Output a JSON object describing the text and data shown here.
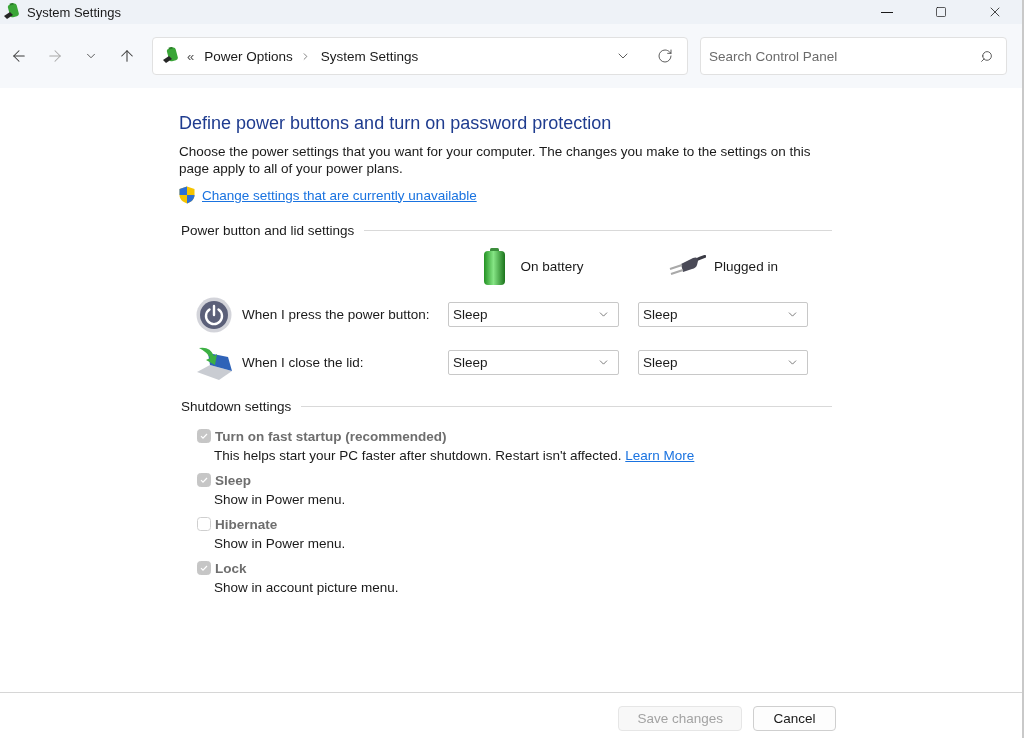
{
  "window": {
    "title": "System Settings"
  },
  "nav_buttons": [
    {
      "kind": "back",
      "disabled": false
    },
    {
      "kind": "forward",
      "disabled": true
    },
    {
      "kind": "recent",
      "disabled": false
    },
    {
      "kind": "up",
      "disabled": false
    }
  ],
  "address_bar": {
    "overflow": "«",
    "breadcrumbs": [
      "Power Options",
      "System Settings"
    ]
  },
  "search": {
    "placeholder": "Search Control Panel"
  },
  "page": {
    "heading": "Define power buttons and turn on password protection",
    "description": "Choose the power settings that you want for your computer. The changes you make to the settings on this page apply to all of your power plans.",
    "admin_link": "Change settings that are currently unavailable"
  },
  "power_settings": {
    "title": "Power button and lid settings",
    "columns": [
      {
        "kind": "battery",
        "label": "On battery"
      },
      {
        "kind": "plug",
        "label": "Plugged in"
      }
    ],
    "rows": [
      {
        "kind": "power",
        "label": "When I press the power button:",
        "values": [
          "Sleep",
          "Sleep"
        ]
      },
      {
        "kind": "lid",
        "label": "When I close the lid:",
        "values": [
          "Sleep",
          "Sleep"
        ]
      }
    ]
  },
  "shutdown_settings": {
    "title": "Shutdown settings",
    "options": [
      {
        "label": "Turn on fast startup (recommended)",
        "description": "This helps start your PC faster after shutdown. Restart isn't affected.",
        "link": "Learn More",
        "checked": true,
        "disabled": true
      },
      {
        "label": "Sleep",
        "description": "Show in Power menu.",
        "checked": true,
        "disabled": true
      },
      {
        "label": "Hibernate",
        "description": "Show in Power menu.",
        "checked": false,
        "disabled": true
      },
      {
        "label": "Lock",
        "description": "Show in account picture menu.",
        "checked": true,
        "disabled": true
      }
    ]
  },
  "buttons": [
    {
      "label": "Save changes",
      "disabled": true
    },
    {
      "label": "Cancel",
      "disabled": false
    }
  ]
}
